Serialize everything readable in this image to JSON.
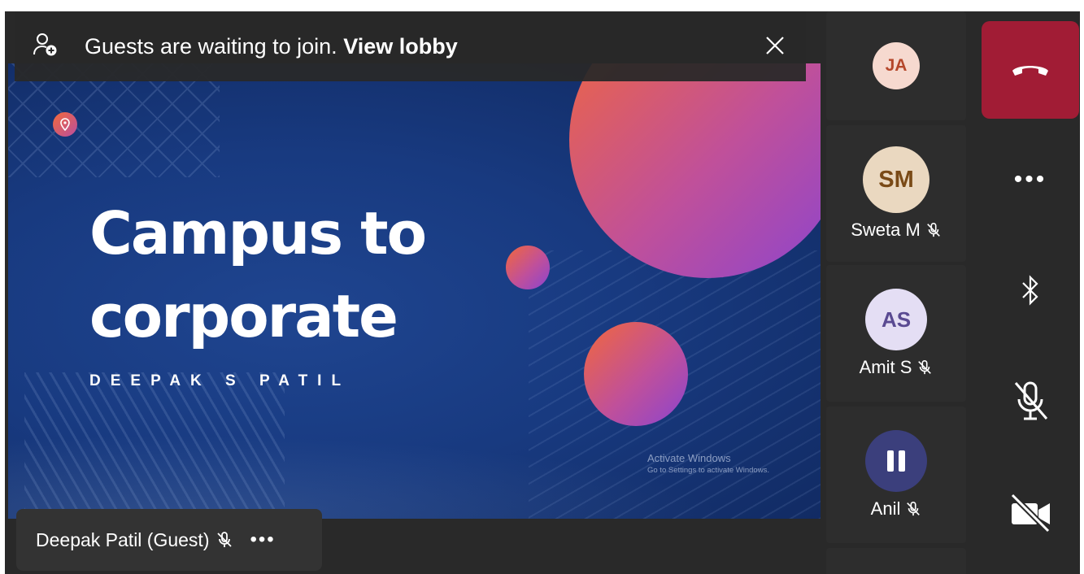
{
  "banner": {
    "message": "Guests are waiting to join.",
    "link": "View lobby",
    "icon": "guest-add-icon",
    "close_icon": "close-icon"
  },
  "slide": {
    "title": "Campus to corporate",
    "subtitle": "DEEPAK S PATIL",
    "watermark_line1": "Activate Windows",
    "watermark_line2": "Go to Settings to activate Windows."
  },
  "presenter": {
    "name": "Deepak Patil (Guest)",
    "more": "•••"
  },
  "participants": [
    {
      "initials": "JA",
      "name": "",
      "avatar_bg": "#f6d9cf",
      "avatar_fg": "#b5472b",
      "muted": false
    },
    {
      "initials": "SM",
      "name": "Sweta M",
      "avatar_bg": "#ead8c0",
      "avatar_fg": "#7a4a16",
      "muted": true
    },
    {
      "initials": "AS",
      "name": "Amit S",
      "avatar_bg": "#e4def4",
      "avatar_fg": "#5a4a92",
      "muted": true
    },
    {
      "initials": "",
      "name": "Anil",
      "avatar_bg": "#3b3f7c",
      "avatar_fg": "#ffffff",
      "muted": true,
      "icon": "pause-icon"
    }
  ],
  "controls": {
    "hangup_icon": "hang-up-icon",
    "more_label": "•••",
    "bluetooth_icon": "bluetooth-icon",
    "mic_icon": "mic-off-icon",
    "camera_icon": "camera-off-icon"
  },
  "colors": {
    "app_bg": "#292929",
    "hangup": "#a11c35",
    "slide_blue": "#183a80",
    "circle_gradient_start": "#f2683a",
    "circle_gradient_end": "#8a44d0"
  }
}
